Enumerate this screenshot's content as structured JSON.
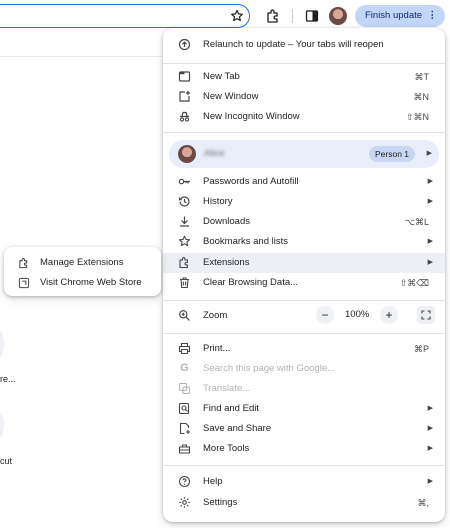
{
  "toolbar": {
    "finish_update": "Finish update",
    "more_dots": "⋮"
  },
  "background": {
    "text_1": "re...",
    "text_2": "cut"
  },
  "menu": {
    "relaunch": "Relaunch to update – Your tabs will reopen",
    "new_tab": {
      "label": "New Tab",
      "shortcut": "⌘T"
    },
    "new_window": {
      "label": "New Window",
      "shortcut": "⌘N"
    },
    "new_incognito": {
      "label": "New Incognito Window",
      "shortcut": "⇧⌘N"
    },
    "profile": {
      "name": "Alice",
      "badge": "Person 1"
    },
    "passwords": {
      "label": "Passwords and Autofill"
    },
    "history": {
      "label": "History"
    },
    "downloads": {
      "label": "Downloads",
      "shortcut": "⌥⌘L"
    },
    "bookmarks": {
      "label": "Bookmarks and lists"
    },
    "extensions": {
      "label": "Extensions"
    },
    "clear_data": {
      "label": "Clear Browsing Data...",
      "shortcut": "⇧⌘⌫"
    },
    "zoom": {
      "label": "Zoom",
      "minus": "−",
      "value": "100%",
      "plus": "+"
    },
    "print": {
      "label": "Print...",
      "shortcut": "⌘P"
    },
    "search_page": {
      "label": "Search this page with Google..."
    },
    "translate": {
      "label": "Translate..."
    },
    "find_edit": {
      "label": "Find and Edit"
    },
    "save_share": {
      "label": "Save and Share"
    },
    "more_tools": {
      "label": "More Tools"
    },
    "help": {
      "label": "Help"
    },
    "settings": {
      "label": "Settings",
      "shortcut": "⌘,"
    },
    "arrow": "▶"
  },
  "submenu": {
    "manage": "Manage Extensions",
    "web_store": "Visit Chrome Web Store"
  },
  "colors": {
    "accent": "#1a73e8",
    "finish_bg": "#c2d7f7",
    "hover_bg": "#eceff4"
  }
}
